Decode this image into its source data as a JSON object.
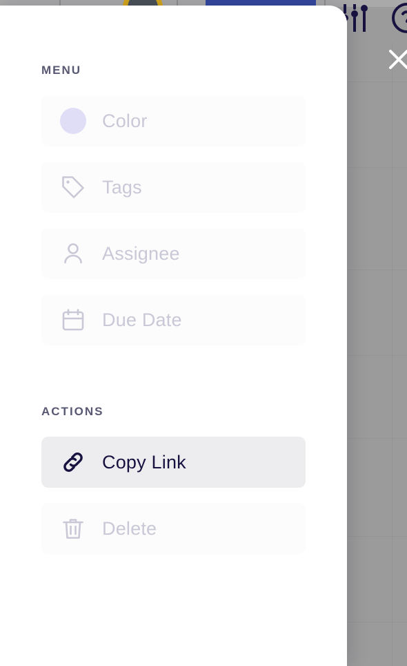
{
  "panel": {
    "menu_heading": "MENU",
    "actions_heading": "ACTIONS",
    "menu_items": [
      {
        "label": "Color",
        "icon": "color-swatch-icon",
        "state": "disabled"
      },
      {
        "label": "Tags",
        "icon": "tag-icon",
        "state": "disabled"
      },
      {
        "label": "Assignee",
        "icon": "person-icon",
        "state": "disabled"
      },
      {
        "label": "Due Date",
        "icon": "calendar-icon",
        "state": "disabled"
      }
    ],
    "action_items": [
      {
        "label": "Copy Link",
        "icon": "link-icon",
        "state": "enabled"
      },
      {
        "label": "Delete",
        "icon": "trash-icon",
        "state": "disabled"
      }
    ]
  },
  "overlay": {
    "close_icon": "close-icon"
  },
  "background": {
    "sliders_icon": "sliders-icon",
    "help_icon": "help-circle-icon"
  },
  "colors": {
    "swatch": "#E0DDF7",
    "enabled_text": "#171240",
    "disabled_text": "#C9C8D6",
    "heading": "#585873",
    "enabled_bg": "#EDEDF0",
    "disabled_bg": "#FCFCFD",
    "scrim": "#9B9B9B",
    "accent_blue": "#34479E",
    "accent_gold": "#D3A61C"
  }
}
